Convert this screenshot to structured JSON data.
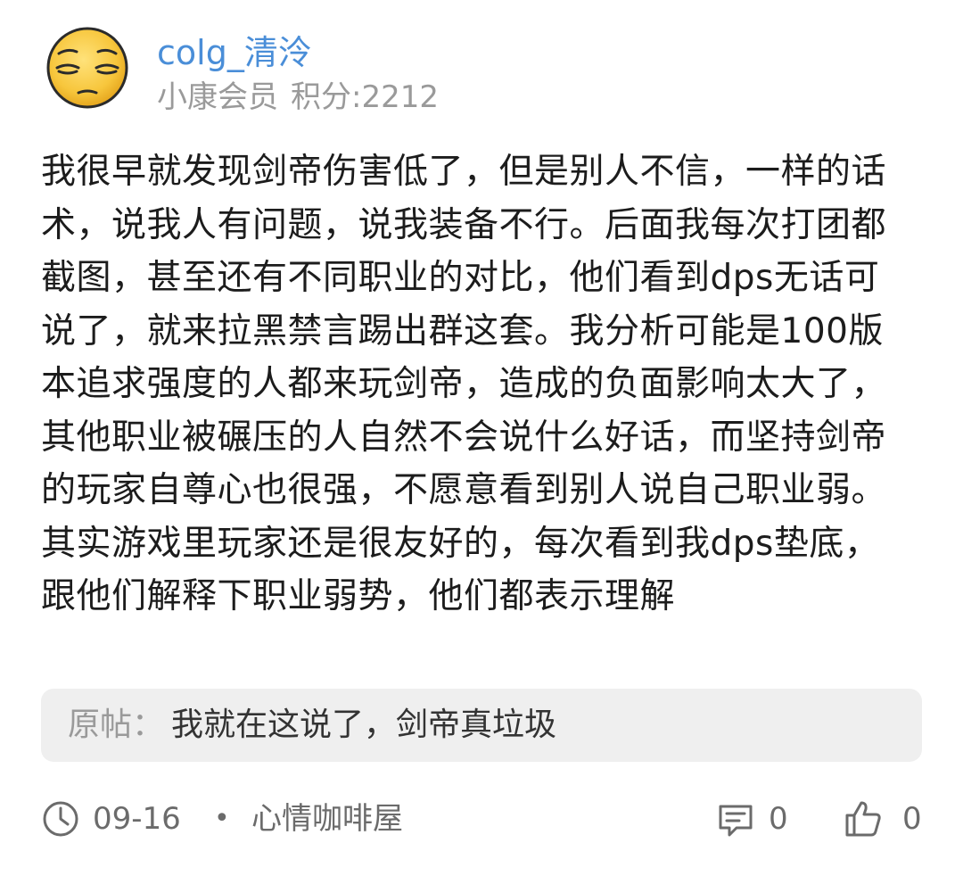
{
  "post": {
    "author": {
      "username": "colg_清泠",
      "level": "小康会员",
      "points": "积分:2212",
      "avatar_icon": "pensive-face-emoji"
    },
    "content": "我很早就发现剑帝伤害低了，但是别人不信，一样的话术，说我人有问题，说我装备不行。后面我每次打团都截图，甚至还有不同职业的对比，他们看到dps无话可说了，就来拉黑禁言踢出群这套。我分析可能是100版本追求强度的人都来玩剑帝，造成的负面影响太大了，其他职业被碾压的人自然不会说什么好话，而坚持剑帝的玩家自尊心也很强，不愿意看到别人说自己职业弱。其实游戏里玩家还是很友好的，每次看到我dps垫底，跟他们解释下职业弱势，他们都表示理解",
    "quote": {
      "label": "原帖：",
      "text": "我就在这说了，剑帝真垃圾"
    },
    "footer": {
      "date": "09-16",
      "separator": "•",
      "board": "心情咖啡屋",
      "comment_count": "0",
      "like_count": "0",
      "icons": [
        "clock-icon",
        "comment-icon",
        "thumbs-up-icon"
      ]
    }
  },
  "colors": {
    "username": "#4a8ed8",
    "meta": "#9a9a9a",
    "quote_bg": "#efefef",
    "avatar_face": "#f7c63c"
  }
}
